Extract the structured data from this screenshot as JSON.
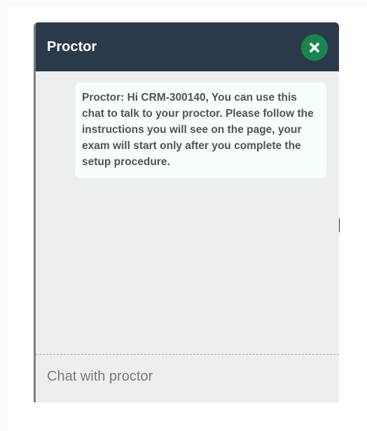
{
  "chat": {
    "title": "Proctor",
    "close_icon": "close-x-icon",
    "messages": [
      {
        "text": "Proctor: Hi CRM-300140, You can use this chat to talk to your proctor. Please follow the instructions you will see on the page, your exam will start only after you complete the setup procedure."
      }
    ],
    "input_placeholder": "Chat with proctor",
    "input_value": ""
  },
  "colors": {
    "header_bg": "#2b3a4a",
    "close_button_bg": "#1b8550",
    "window_bg": "#eceeef",
    "bubble_bg": "#f6fefe",
    "message_text": "#545454"
  }
}
